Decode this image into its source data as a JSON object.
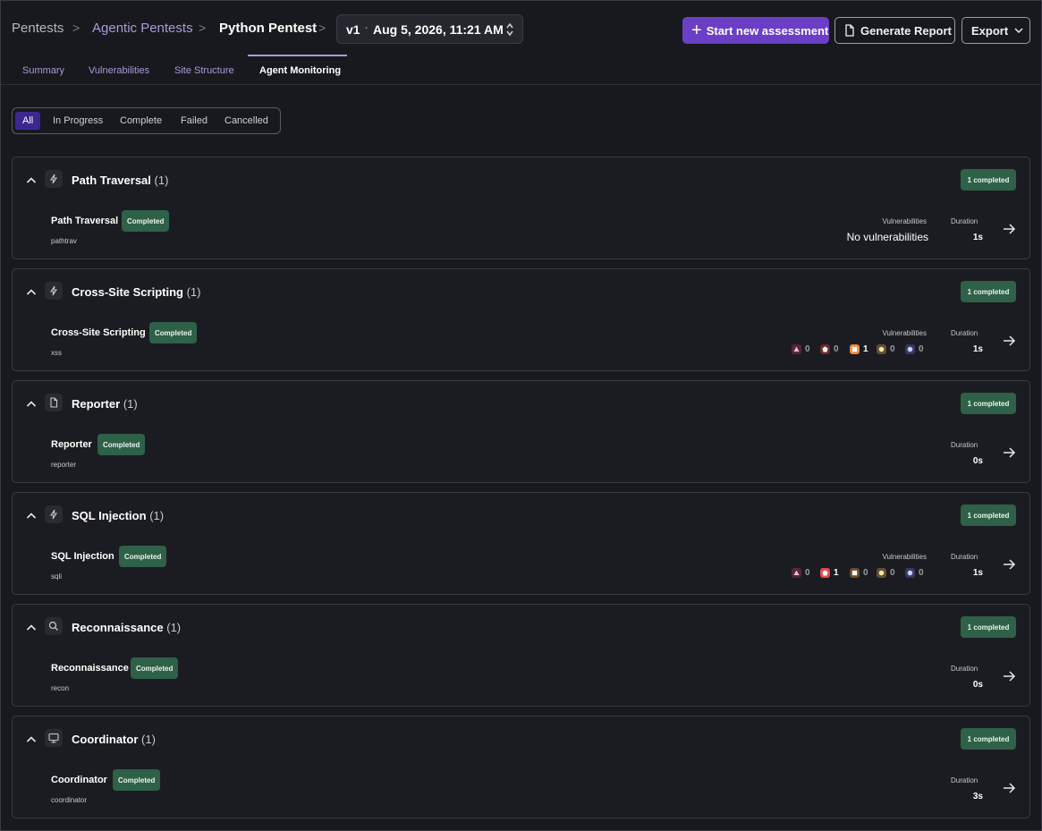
{
  "breadcrumb": {
    "items": [
      "Pentests",
      "Agentic Pentests",
      "Python Pentest"
    ],
    "separator": ">"
  },
  "version": {
    "label": "v1",
    "dot": "·",
    "datetime": "Aug 5, 2026, 11:21 AM"
  },
  "actions": {
    "start_label": "Start new assessment",
    "report_label": "Generate Report",
    "export_label": "Export"
  },
  "tabs": [
    {
      "label": "Summary",
      "active": false
    },
    {
      "label": "Vulnerabilities",
      "active": false
    },
    {
      "label": "Site Structure",
      "active": false
    },
    {
      "label": "Agent Monitoring",
      "active": true
    }
  ],
  "filters": [
    "All",
    "In Progress",
    "Complete",
    "Failed",
    "Cancelled"
  ],
  "active_filter": "All",
  "labels": {
    "vulnerabilities": "Vulnerabilities",
    "duration": "Duration"
  },
  "groups": [
    {
      "icon": "lightning-icon",
      "title": "Path Traversal",
      "count": "(1)",
      "badge": "1 completed",
      "agent": {
        "name": "Path Traversal",
        "status": "Completed",
        "id": "pathtrav",
        "duration": "1s",
        "vuln_text": "No vulnerabilities",
        "severity": null
      }
    },
    {
      "icon": "lightning-icon",
      "title": "Cross-Site Scripting",
      "count": "(1)",
      "badge": "1 completed",
      "agent": {
        "name": "Cross-Site Scripting",
        "status": "Completed",
        "id": "xss",
        "duration": "1s",
        "vuln_text": null,
        "severity": [
          {
            "level": "critical",
            "count": "0"
          },
          {
            "level": "high",
            "count": "0"
          },
          {
            "level": "medium",
            "count": "1"
          },
          {
            "level": "low",
            "count": "0"
          },
          {
            "level": "info",
            "count": "0"
          }
        ]
      }
    },
    {
      "icon": "document-icon",
      "title": "Reporter",
      "count": "(1)",
      "badge": "1 completed",
      "agent": {
        "name": "Reporter",
        "status": "Completed",
        "id": "reporter",
        "duration": "0s",
        "vuln_text": null,
        "severity": null
      }
    },
    {
      "icon": "lightning-icon",
      "title": "SQL Injection",
      "count": "(1)",
      "badge": "1 completed",
      "agent": {
        "name": "SQL Injection",
        "status": "Completed",
        "id": "sqli",
        "duration": "1s",
        "vuln_text": null,
        "severity": [
          {
            "level": "critical",
            "count": "0"
          },
          {
            "level": "high",
            "count": "1"
          },
          {
            "level": "medium",
            "count": "0"
          },
          {
            "level": "low",
            "count": "0"
          },
          {
            "level": "info",
            "count": "0"
          }
        ]
      }
    },
    {
      "icon": "search-icon",
      "title": "Reconnaissance",
      "count": "(1)",
      "badge": "1 completed",
      "agent": {
        "name": "Reconnaissance",
        "status": "Completed",
        "id": "recon",
        "duration": "0s",
        "vuln_text": null,
        "severity": null
      }
    },
    {
      "icon": "monitor-icon",
      "title": "Coordinator",
      "count": "(1)",
      "badge": "1 completed",
      "agent": {
        "name": "Coordinator",
        "status": "Completed",
        "id": "coordinator",
        "duration": "3s",
        "vuln_text": null,
        "severity": null
      }
    }
  ],
  "colors": {
    "accent": "#6a3fc6",
    "success_badge": "#2f6048",
    "critical": "#9a3a5a",
    "high": "#e5484d",
    "medium": "#f08a3c",
    "low": "#b5902f",
    "info": "#5a6ab5"
  }
}
